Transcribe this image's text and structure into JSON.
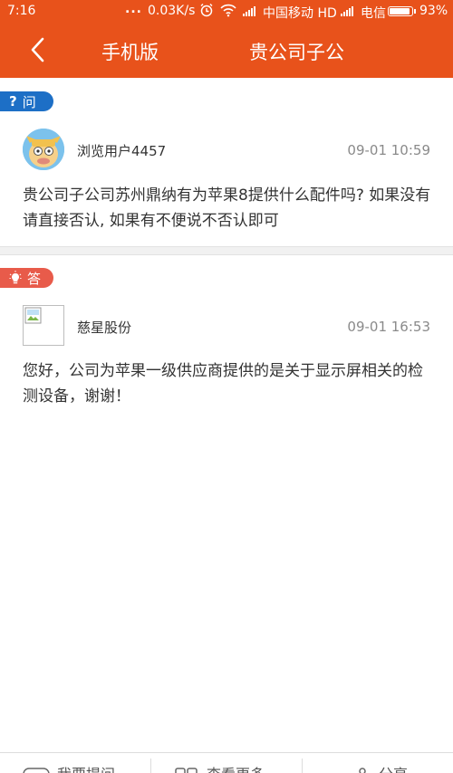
{
  "status_bar": {
    "time": "7:16",
    "dots": "...",
    "speed": "0.03K/s",
    "carrier1": "中国移动 HD",
    "carrier2": "电信",
    "battery": "93%"
  },
  "navbar": {
    "mobile_label": "手机版",
    "title": "贵公司子公"
  },
  "question": {
    "tag": "问",
    "user": "浏览用户4457",
    "time": "09-01 10:59",
    "text": "贵公司子公司苏州鼎纳有为苹果8提供什么配件吗? 如果没有请直接否认, 如果有不便说不否认即可"
  },
  "answer": {
    "tag": "答",
    "user": "慈星股份",
    "time": "09-01 16:53",
    "text": "您好，公司为苹果一级供应商提供的是关于显示屏相关的检测设备，谢谢！"
  },
  "bottom_bar": {
    "item1": "我要提问",
    "item2": "查看更多",
    "item3": "分享"
  },
  "colors": {
    "brand": "#e8521b",
    "question_tag": "#1d6fc6",
    "answer_tag": "#e85b4a"
  },
  "icons": [
    "back-arrow-icon",
    "question-mark-icon",
    "lightbulb-icon",
    "wifi-icon",
    "alarm-icon",
    "avatar-cartoon",
    "broken-image-icon"
  ]
}
